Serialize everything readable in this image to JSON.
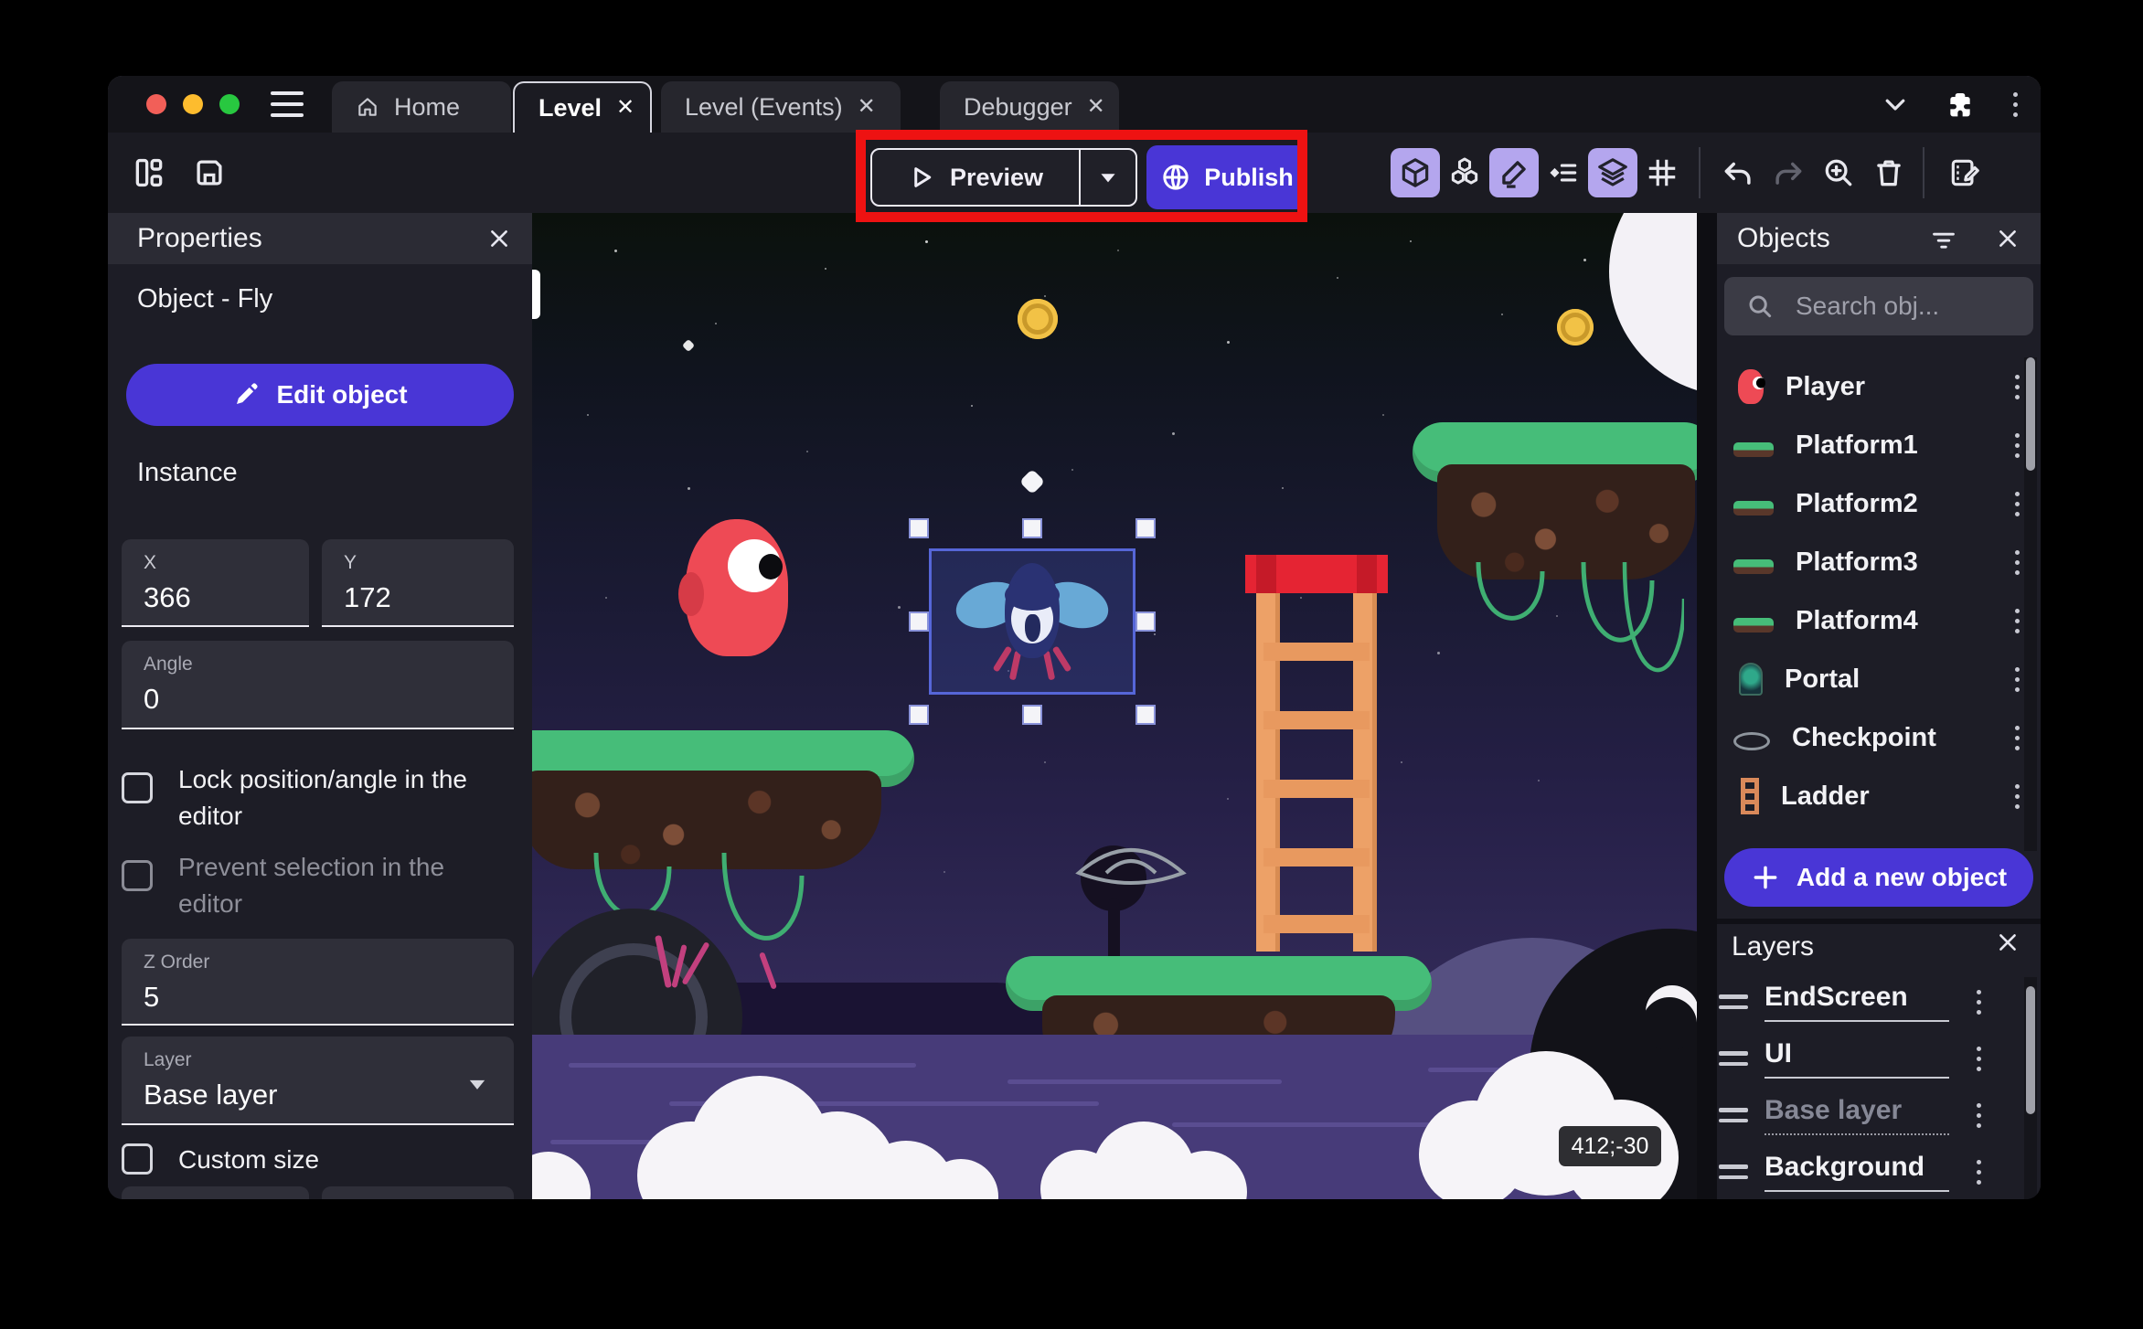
{
  "app": {
    "accent_color": "#4936d6",
    "toggle_icon_bg": "#b4a6ee",
    "annotation_color": "#ee1212",
    "traffic_lights": [
      "#f25f58",
      "#fdbc2e",
      "#28c840"
    ]
  },
  "tabbar": {
    "tabs": [
      {
        "label": "Home"
      },
      {
        "label": "Level",
        "active": true,
        "closable": true
      },
      {
        "label": "Level (Events)",
        "closable": true
      },
      {
        "label": "Debugger",
        "closable": true
      }
    ],
    "window_icons": [
      "chevron-down-icon",
      "extensions-icon",
      "more-vert-icon"
    ]
  },
  "toolbar": {
    "preview_label": "Preview",
    "publish_label": "Publish",
    "left_icons": [
      "layout-icon",
      "save-icon"
    ],
    "right_icons": [
      "objects-cube-icon",
      "object-groups-icon",
      "properties-pencil-icon",
      "instances-list-icon",
      "layers-icon",
      "grid-icon",
      "undo-icon",
      "redo-icon",
      "zoom-in-icon",
      "trash-icon",
      "edit-scene-icon"
    ]
  },
  "properties_panel": {
    "title": "Properties",
    "object_label": "Object  - Fly",
    "edit_button": "Edit object",
    "section_instance": "Instance",
    "fields": {
      "x_label": "X",
      "x_value": "366",
      "y_label": "Y",
      "y_value": "172",
      "angle_label": "Angle",
      "angle_value": "0",
      "z_order_label": "Z Order",
      "z_order_value": "5",
      "layer_label": "Layer",
      "layer_value": "Base layer"
    },
    "checkboxes": {
      "lock": "Lock position/angle in the editor",
      "prevent": "Prevent selection in the editor",
      "custom_size": "Custom size"
    }
  },
  "objects_panel": {
    "title": "Objects",
    "search_placeholder": "Search obj...",
    "items": [
      {
        "name": "Player",
        "thumb": "player"
      },
      {
        "name": "Platform1",
        "thumb": "plat"
      },
      {
        "name": "Platform2",
        "thumb": "plat"
      },
      {
        "name": "Platform3",
        "thumb": "plat"
      },
      {
        "name": "Platform4",
        "thumb": "plat tall"
      },
      {
        "name": "Portal",
        "thumb": "portal"
      },
      {
        "name": "Checkpoint",
        "thumb": "checkpoint"
      },
      {
        "name": "Ladder",
        "thumb": "ladder"
      }
    ],
    "add_button": "Add a new object"
  },
  "layers_panel": {
    "title": "Layers",
    "items": [
      {
        "name": "EndScreen"
      },
      {
        "name": "UI"
      },
      {
        "name": "Base layer",
        "dimmed": true
      },
      {
        "name": "Background"
      }
    ]
  },
  "canvas": {
    "cursor_coordinates": "412;-30",
    "selected_object": "Fly"
  }
}
